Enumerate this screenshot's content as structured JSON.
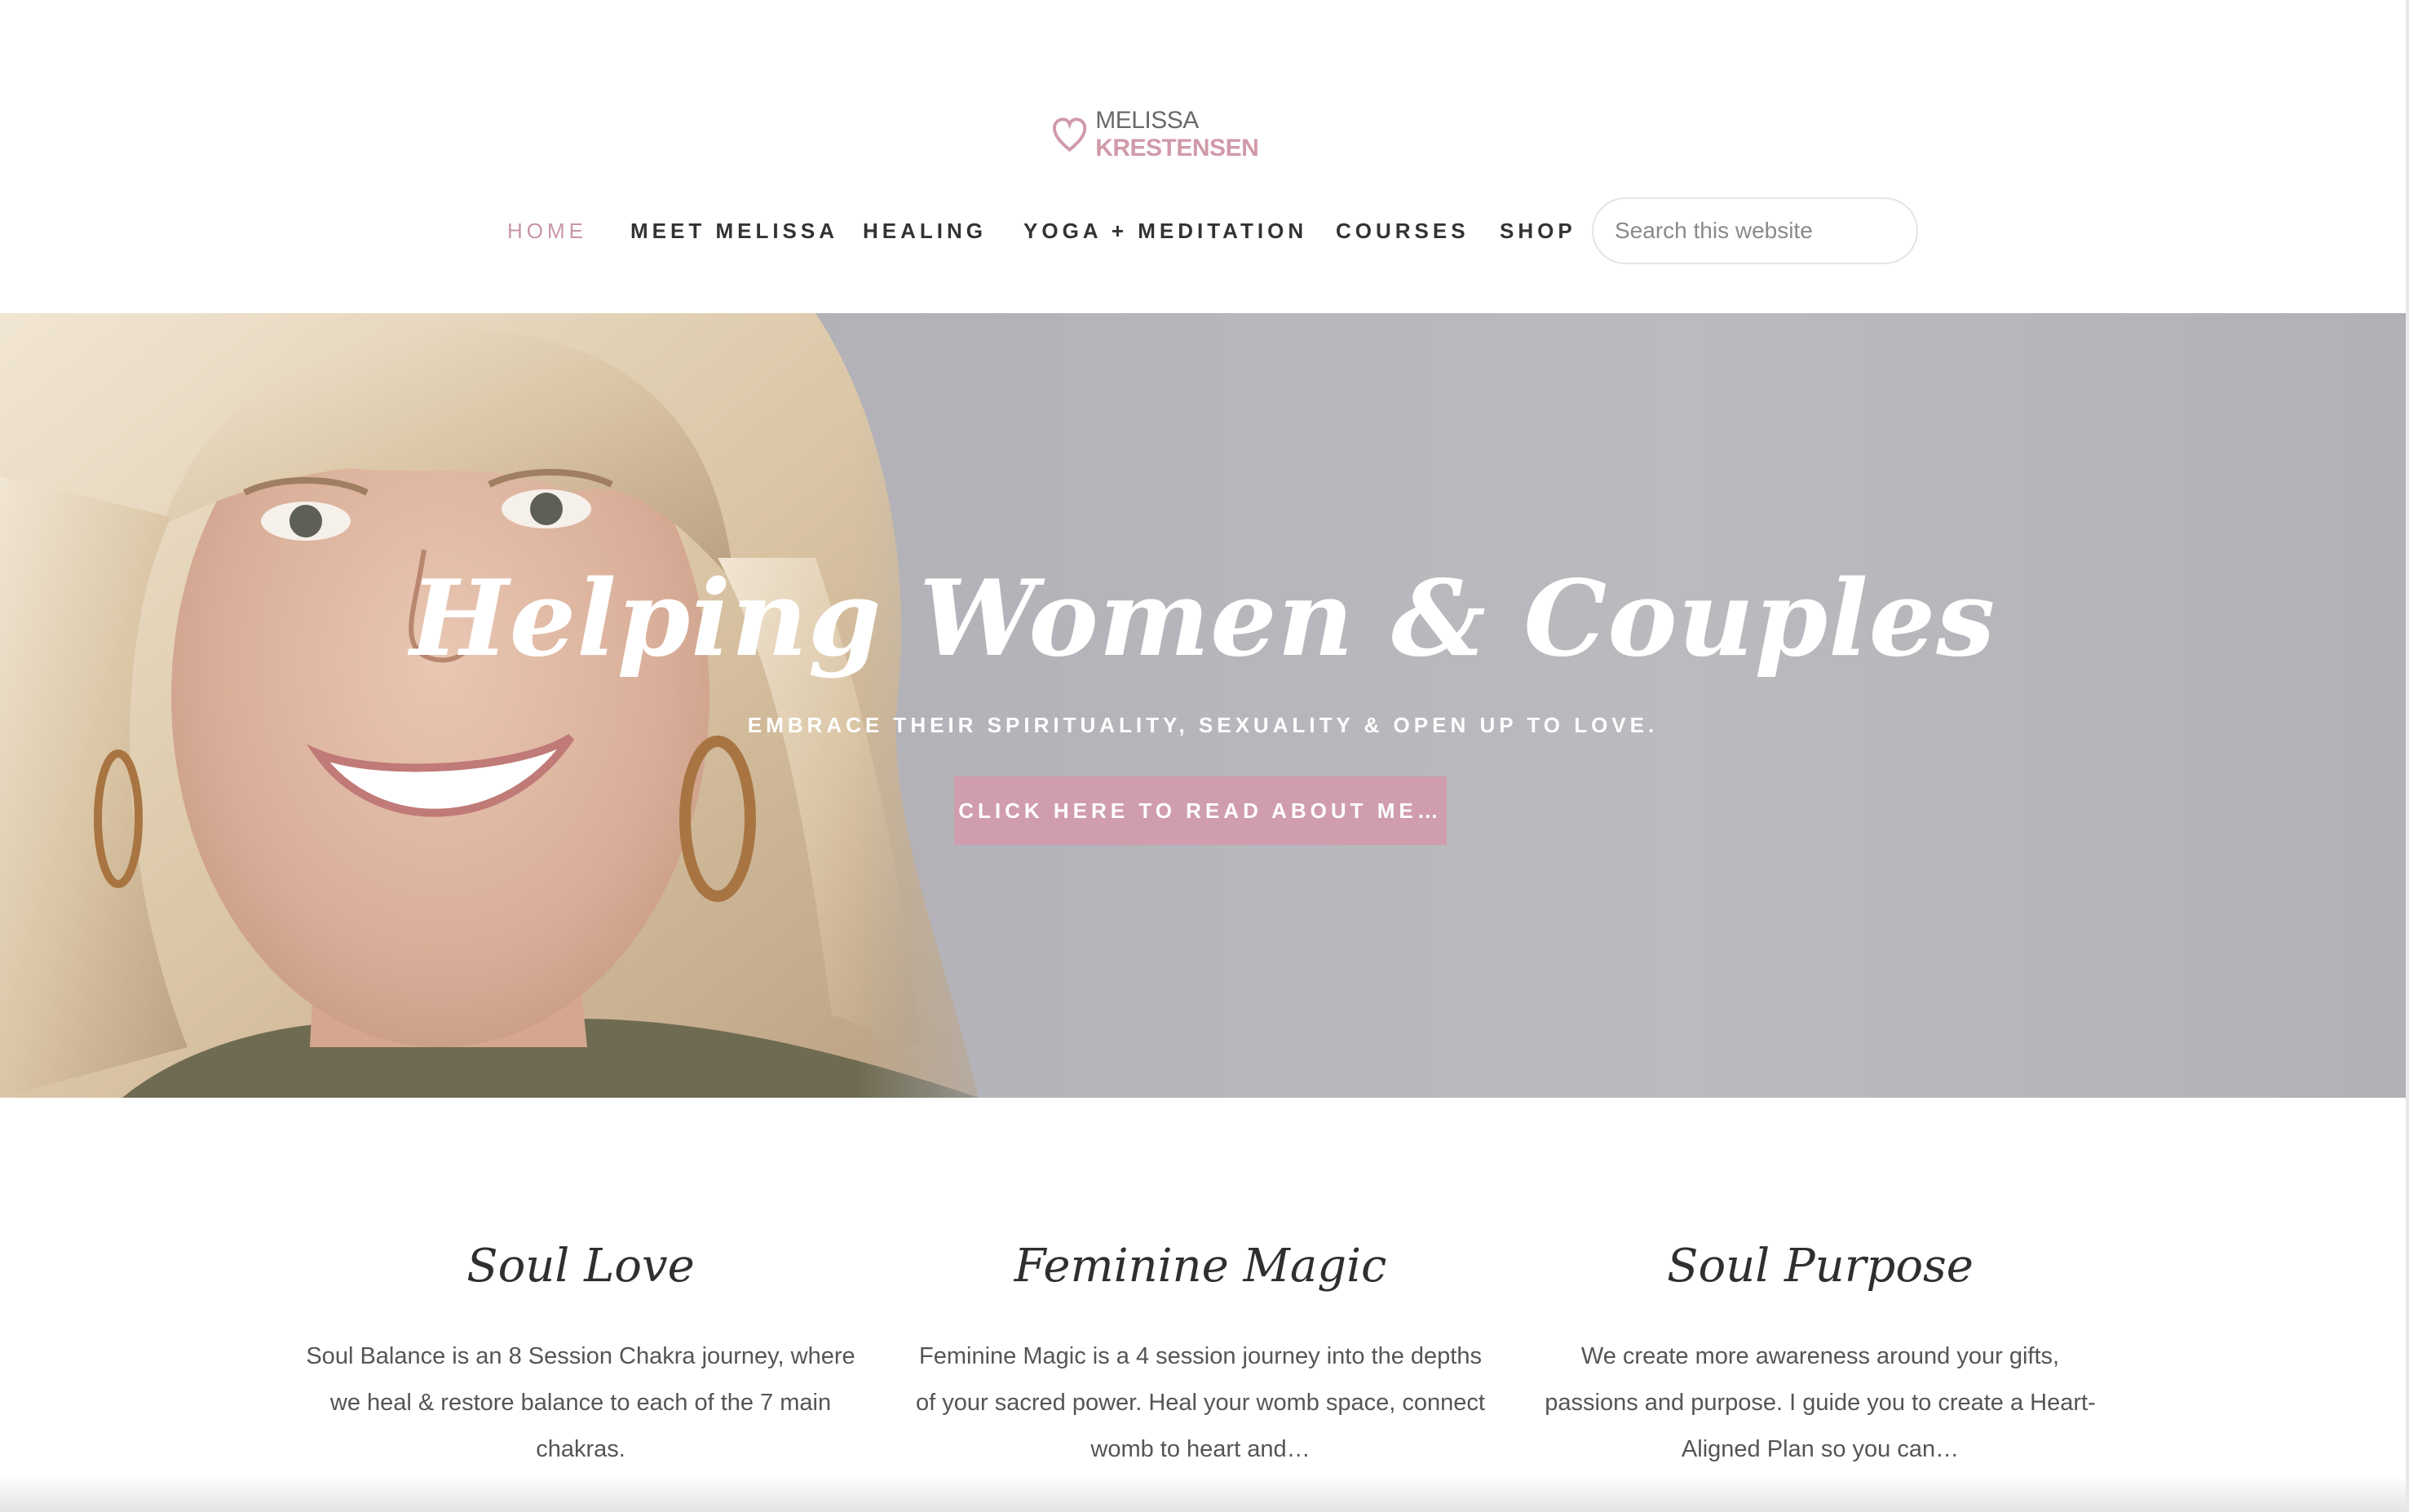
{
  "header": {
    "logo": {
      "first": "MELISSA",
      "last": "KRESTENSEN",
      "icon": "heart-icon",
      "accent": "#d19aa9"
    },
    "nav": [
      {
        "label": "HOME",
        "active": true
      },
      {
        "label": "MEET MELISSA",
        "active": false
      },
      {
        "label": "HEALING",
        "active": false
      },
      {
        "label": "YOGA + MEDITATION",
        "active": false
      },
      {
        "label": "COURSES",
        "active": false
      },
      {
        "label": "SHOP",
        "active": false
      }
    ],
    "search": {
      "placeholder": "Search this website"
    }
  },
  "hero": {
    "title": "Helping Women & Couples",
    "subtitle": "EMBRACE THEIR SPIRITUALITY, SEXUALITY & OPEN UP TO LOVE.",
    "button_label": "CLICK HERE TO READ ABOUT ME…",
    "button_color": "#cf9dae"
  },
  "features": [
    {
      "title": "Soul Love",
      "text": "Soul Balance is an 8 Session Chakra journey, where we heal & restore balance to each of the 7 main chakras."
    },
    {
      "title": "Feminine Magic",
      "text": "Feminine Magic is a 4 session journey into the depths of your sacred power. Heal your womb space, connect womb to heart and…"
    },
    {
      "title": "Soul Purpose",
      "text": "We create more awareness around your gifts, passions and purpose. I guide you to create a Heart-Aligned Plan so you can…"
    }
  ]
}
